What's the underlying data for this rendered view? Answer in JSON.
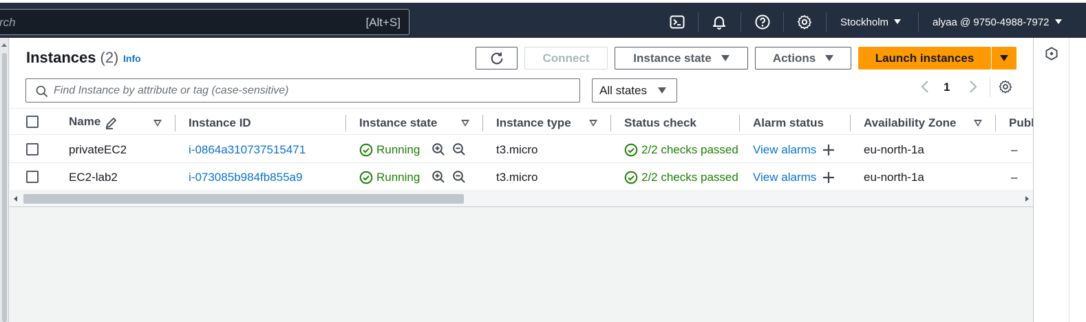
{
  "topbar": {
    "search_placeholder": "rch",
    "search_shortcut": "[Alt+S]",
    "region": "Stockholm",
    "account": "alyaa @ 9750-4988-7972"
  },
  "header": {
    "title": "Instances",
    "count": "(2)",
    "info": "Info"
  },
  "toolbar": {
    "connect": "Connect",
    "instance_state": "Instance state",
    "actions": "Actions",
    "launch": "Launch instances"
  },
  "filter": {
    "placeholder": "Find Instance by attribute or tag (case-sensitive)",
    "state_select": "All states"
  },
  "pagination": {
    "current_page": "1"
  },
  "table": {
    "columns": [
      "Name",
      "Instance ID",
      "Instance state",
      "Instance type",
      "Status check",
      "Alarm status",
      "Availability Zone",
      "Publ"
    ],
    "rows": [
      {
        "name": "privateEC2",
        "id": "i-0864a310737515471",
        "state": "Running",
        "type": "t3.micro",
        "status": "2/2 checks passed",
        "alarm": "View alarms",
        "az": "eu-north-1a",
        "public": "–"
      },
      {
        "name": "EC2-lab2",
        "id": "i-073085b984fb855a9",
        "state": "Running",
        "type": "t3.micro",
        "status": "2/2 checks passed",
        "alarm": "View alarms",
        "az": "eu-north-1a",
        "public": "–"
      }
    ]
  },
  "colors": {
    "topbar": "#232f3e",
    "primary": "#ff9900",
    "link": "#0972d3",
    "success": "#1d8102"
  }
}
